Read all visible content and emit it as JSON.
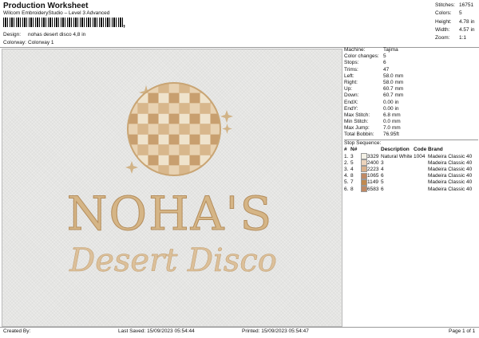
{
  "header": {
    "title": "Production Worksheet",
    "software": "Wilcom EmbroideryStudio – Level 3 Advanced",
    "design_label": "Design:",
    "design_value": "nohas desert disco 4,8 in",
    "colorway_label": "Colorway:",
    "colorway_value": "Colorway 1"
  },
  "stats": [
    {
      "k": "Stitches:",
      "v": "16751"
    },
    {
      "k": "Colors:",
      "v": "5"
    },
    {
      "k": "Height:",
      "v": "4.78 in"
    },
    {
      "k": "Width:",
      "v": "4.57 in"
    },
    {
      "k": "Zoom:",
      "v": "1:1"
    }
  ],
  "machine": [
    {
      "k": "Machine:",
      "v": "Tajima"
    },
    {
      "k": "Color changes:",
      "v": "5"
    },
    {
      "k": "Stops:",
      "v": "6"
    },
    {
      "k": "Trims:",
      "v": "47"
    },
    {
      "k": "Left:",
      "v": "58.0 mm"
    },
    {
      "k": "Right:",
      "v": "58.0 mm"
    },
    {
      "k": "Up:",
      "v": "60.7 mm"
    },
    {
      "k": "Down:",
      "v": "60.7 mm"
    },
    {
      "k": "EndX:",
      "v": "0.00 in"
    },
    {
      "k": "EndY:",
      "v": "0.00 in"
    },
    {
      "k": "Max Stitch:",
      "v": "6.8 mm"
    },
    {
      "k": "Min Stitch:",
      "v": "0.0 mm"
    },
    {
      "k": "Max Jump:",
      "v": "7.0 mm"
    },
    {
      "k": "Total Bobbin:",
      "v": "76.95ft"
    }
  ],
  "sequence": {
    "label": "Stop Sequence:",
    "headers": [
      "#",
      "N#",
      "",
      "",
      "Description",
      "Code",
      "Brand"
    ],
    "rows": [
      {
        "a": "1.",
        "n": "3",
        "color": "#f4f1e6",
        "code_num": "3329",
        "desc": "Natural White",
        "code": "1004",
        "brand": "Madeira Classic 40"
      },
      {
        "a": "2.",
        "n": "5",
        "color": "#ecd3bb",
        "code_num": "2400",
        "desc": "3",
        "code": "",
        "brand": "Madeira Classic 40"
      },
      {
        "a": "3.",
        "n": "4",
        "color": "#d9b18c",
        "code_num": "2223",
        "desc": "4",
        "code": "",
        "brand": "Madeira Classic 40"
      },
      {
        "a": "4.",
        "n": "8",
        "color": "#c08963",
        "code_num": "1065",
        "desc": "6",
        "code": "",
        "brand": "Madeira Classic 40"
      },
      {
        "a": "5.",
        "n": "7",
        "color": "#c0894f",
        "code_num": "1149",
        "desc": "5",
        "code": "",
        "brand": "Madeira Classic 40"
      },
      {
        "a": "6.",
        "n": "8",
        "color": "#c08963",
        "code_num": "6583",
        "desc": "6",
        "code": "",
        "brand": "Madeira Classic 40"
      }
    ]
  },
  "logo": {
    "name": "NOHA'S",
    "tagline": "Desert Disco"
  },
  "footer": {
    "created": "Created By:",
    "saved": "Last Saved: 15/09/2023 05:54:44",
    "printed": "Printed: 15/09/2023 05:54:47",
    "page": "Page 1 of 1"
  }
}
